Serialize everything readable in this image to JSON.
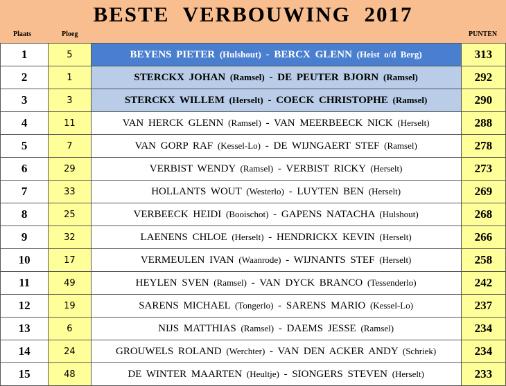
{
  "title": "BESTE  VERBOUWING  2017",
  "headers": {
    "plaats": "Plaats",
    "ploeg": "Ploeg",
    "punten": "PUNTEN"
  },
  "rows": [
    {
      "plaats": "1",
      "ploeg": "5",
      "name1": "BEYENS  PIETER",
      "loc1": "(Hulshout)",
      "name2": "BERCX  GLENN",
      "loc2": "(Heist o/d Berg)",
      "punten": "313"
    },
    {
      "plaats": "2",
      "ploeg": "1",
      "name1": "STERCKX  JOHAN",
      "loc1": "(Ramsel)",
      "name2": "DE PEUTER  BJORN",
      "loc2": "(Ramsel)",
      "punten": "292"
    },
    {
      "plaats": "3",
      "ploeg": "3",
      "name1": "STERCKX  WILLEM",
      "loc1": "(Herselt)",
      "name2": "COECK  CHRISTOPHE",
      "loc2": "(Ramsel)",
      "punten": "290"
    },
    {
      "plaats": "4",
      "ploeg": "11",
      "name1": "VAN HERCK  GLENN",
      "loc1": "(Ramsel)",
      "name2": "VAN MEERBEECK  NICK",
      "loc2": "(Herselt)",
      "punten": "288"
    },
    {
      "plaats": "5",
      "ploeg": "7",
      "name1": "VAN GORP  RAF",
      "loc1": "(Kessel-Lo)",
      "name2": "DE WIJNGAERT  STEF",
      "loc2": "(Ramsel)",
      "punten": "278"
    },
    {
      "plaats": "6",
      "ploeg": "29",
      "name1": "VERBIST  WENDY",
      "loc1": "(Ramsel)",
      "name2": "VERBIST  RICKY",
      "loc2": "(Herselt)",
      "punten": "273"
    },
    {
      "plaats": "7",
      "ploeg": "33",
      "name1": "HOLLANTS  WOUT",
      "loc1": "(Westerlo)",
      "name2": "LUYTEN  BEN",
      "loc2": "(Herselt)",
      "punten": "269"
    },
    {
      "plaats": "8",
      "ploeg": "25",
      "name1": "VERBEECK  HEIDI",
      "loc1": "(Booischot)",
      "name2": "GAPENS  NATACHA",
      "loc2": "(Hulshout)",
      "punten": "268"
    },
    {
      "plaats": "9",
      "ploeg": "32",
      "name1": "LAENENS  CHLOE",
      "loc1": "(Herselt)",
      "name2": "HENDRICKX  KEVIN",
      "loc2": "(Herselt)",
      "punten": "266"
    },
    {
      "plaats": "10",
      "ploeg": "17",
      "name1": "VERMEULEN  IVAN",
      "loc1": "(Waanrode)",
      "name2": "WIJNANTS  STEF",
      "loc2": "(Herselt)",
      "punten": "258"
    },
    {
      "plaats": "11",
      "ploeg": "49",
      "name1": "HEYLEN  SVEN",
      "loc1": "(Ramsel)",
      "name2": "VAN DYCK  BRANCO",
      "loc2": "(Tessenderlo)",
      "punten": "242"
    },
    {
      "plaats": "12",
      "ploeg": "19",
      "name1": "SARENS  MICHAEL",
      "loc1": "(Tongerlo)",
      "name2": "SARENS  MARIO",
      "loc2": "(Kessel-Lo)",
      "punten": "237"
    },
    {
      "plaats": "13",
      "ploeg": "6",
      "name1": "NIJS  MATTHIAS",
      "loc1": "(Ramsel)",
      "name2": "DAEMS JESSE",
      "loc2": "(Ramsel)",
      "punten": "234"
    },
    {
      "plaats": "14",
      "ploeg": "24",
      "name1": "GROUWELS  ROLAND",
      "loc1": "(Werchter)",
      "name2": "VAN DEN ACKER  ANDY",
      "loc2": "(Schriek)",
      "punten": "234"
    },
    {
      "plaats": "15",
      "ploeg": "48",
      "name1": "DE WINTER  MAARTEN",
      "loc1": "(Heultje)",
      "name2": "SIONGERS  STEVEN",
      "loc2": "(Herselt)",
      "punten": "233"
    }
  ],
  "colors": {
    "header_bg": "#f9be8f",
    "ploeg_points_bg": "#ffff99",
    "first_place_bg": "#4a7fcf",
    "podium_bg": "#b9cde8"
  }
}
